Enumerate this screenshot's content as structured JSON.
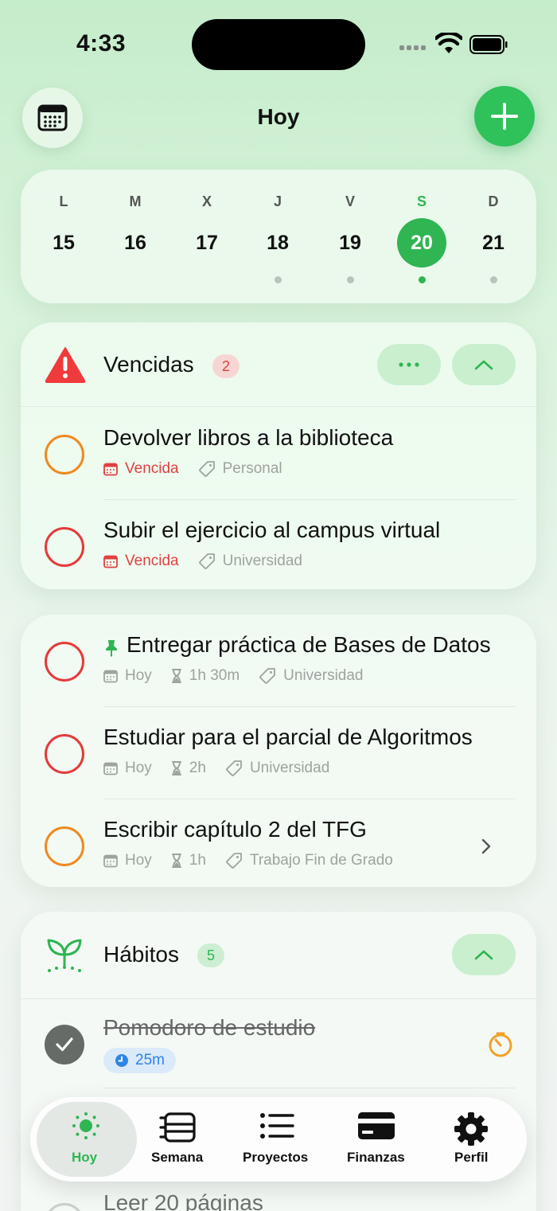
{
  "status_bar": {
    "time": "4:33"
  },
  "header": {
    "title": "Hoy"
  },
  "week": [
    {
      "letter": "L",
      "num": "15",
      "has_dot": false,
      "active": false
    },
    {
      "letter": "M",
      "num": "16",
      "has_dot": false,
      "active": false
    },
    {
      "letter": "X",
      "num": "17",
      "has_dot": false,
      "active": false
    },
    {
      "letter": "J",
      "num": "18",
      "has_dot": true,
      "active": false
    },
    {
      "letter": "V",
      "num": "19",
      "has_dot": true,
      "active": false
    },
    {
      "letter": "S",
      "num": "20",
      "has_dot": true,
      "active": true
    },
    {
      "letter": "D",
      "num": "21",
      "has_dot": true,
      "active": false
    }
  ],
  "overdue": {
    "title": "Vencidas",
    "count": "2",
    "tasks": [
      {
        "title": "Devolver libros a la biblioteca",
        "status": "Vencida",
        "tag": "Personal",
        "priority": "orange"
      },
      {
        "title": "Subir el ejercicio al campus virtual",
        "status": "Vencida",
        "tag": "Universidad",
        "priority": "red"
      }
    ]
  },
  "today": {
    "tasks": [
      {
        "title": "Entregar práctica de Bases de Datos",
        "date": "Hoy",
        "duration": "1h 30m",
        "tag": "Universidad",
        "pinned": true,
        "priority": "red"
      },
      {
        "title": "Estudiar para el parcial de Algoritmos",
        "date": "Hoy",
        "duration": "2h",
        "tag": "Universidad",
        "pinned": false,
        "priority": "red"
      },
      {
        "title": "Escribir capítulo 2 del TFG",
        "date": "Hoy",
        "duration": "1h",
        "tag": "Trabajo Fin de Grado",
        "pinned": false,
        "priority": "orange"
      }
    ]
  },
  "habits": {
    "title": "Hábitos",
    "count": "5",
    "items": [
      {
        "title": "Pomodoro de estudio",
        "timer": "25m",
        "done": true
      },
      {
        "title": "Leer 20 páginas",
        "done": false
      }
    ]
  },
  "nav": [
    {
      "label": "Hoy",
      "icon": "sun-icon",
      "active": true
    },
    {
      "label": "Semana",
      "icon": "week-icon",
      "active": false
    },
    {
      "label": "Proyectos",
      "icon": "list-icon",
      "active": false
    },
    {
      "label": "Finanzas",
      "icon": "card-icon",
      "active": false
    },
    {
      "label": "Perfil",
      "icon": "gear-icon",
      "active": false
    }
  ],
  "colors": {
    "accent": "#2fb552",
    "danger": "#e53a3a",
    "warning": "#ef8a1f"
  }
}
